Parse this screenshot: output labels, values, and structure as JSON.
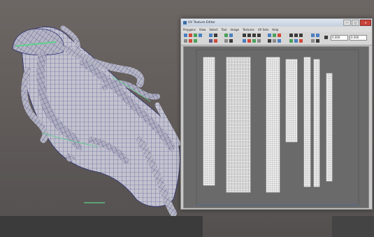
{
  "window": {
    "title": "UV Texture Editor",
    "menus": [
      "Polygons",
      "View",
      "Select",
      "Tool",
      "Image",
      "Textures",
      "UV Sets",
      "Help"
    ],
    "fields": [
      "0.000",
      "0.000"
    ],
    "controls": {
      "minimize": "─",
      "maximize": "□",
      "close": "✕"
    }
  },
  "colors": {
    "viewport_bg": "#645e5c",
    "mesh_fill": "#b9b9c6",
    "mesh_wire": "#3a3f8a",
    "selection_edge": "#5fd08a",
    "uv_canvas": "#6a6a6a",
    "uv_shell": "#e6e6e6"
  },
  "icons": [
    "app-icon",
    "select-tool-icon",
    "move-tool-icon",
    "rotate-tool-icon",
    "scale-tool-icon",
    "flip-icon",
    "snap-icon",
    "checker-icon",
    "grid-icon",
    "image-toggle-icon",
    "dim-image-icon",
    "shade-uv-icon"
  ]
}
